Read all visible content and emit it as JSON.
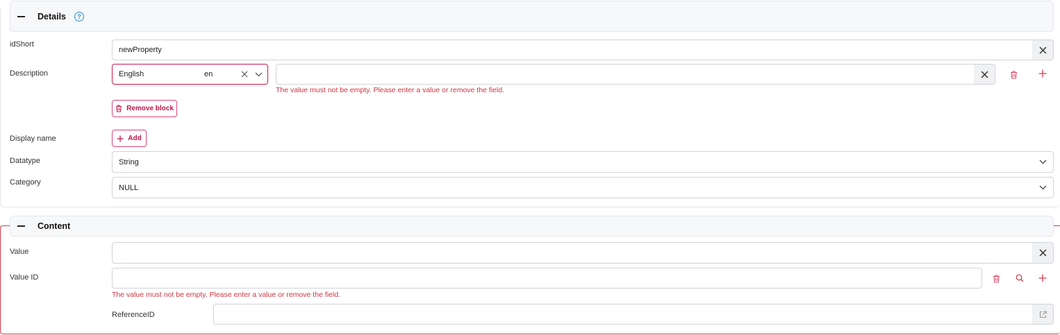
{
  "details": {
    "title": "Details",
    "help_glyph": "?",
    "fields": {
      "idshort_label": "idShort",
      "idshort_value": "newProperty",
      "description_label": "Description",
      "description_language": "English",
      "description_lang_code": "en",
      "description_value": "",
      "description_error": "The value must not be empty. Please enter a value or remove the field.",
      "remove_block_label": "Remove block",
      "display_name_label": "Display name",
      "add_label": "Add",
      "datatype_label": "Datatype",
      "datatype_value": "String",
      "category_label": "Category",
      "category_value": "NULL"
    }
  },
  "content": {
    "title": "Content",
    "fields": {
      "value_label": "Value",
      "value_value": "",
      "value_id_label": "Value ID",
      "value_id_value": "",
      "value_id_error": "The value must not be empty. Please enter a value or remove the field.",
      "reference_id_label": "ReferenceID",
      "reference_id_value": ""
    }
  },
  "icons": [
    "help-icon",
    "clear-icon",
    "chevron-down-icon",
    "trash-icon",
    "plus-icon",
    "search-icon",
    "external-link-icon"
  ],
  "colors": {
    "accent": "#c8194a",
    "error": "#d2343f",
    "help": "#2a8fd6"
  }
}
